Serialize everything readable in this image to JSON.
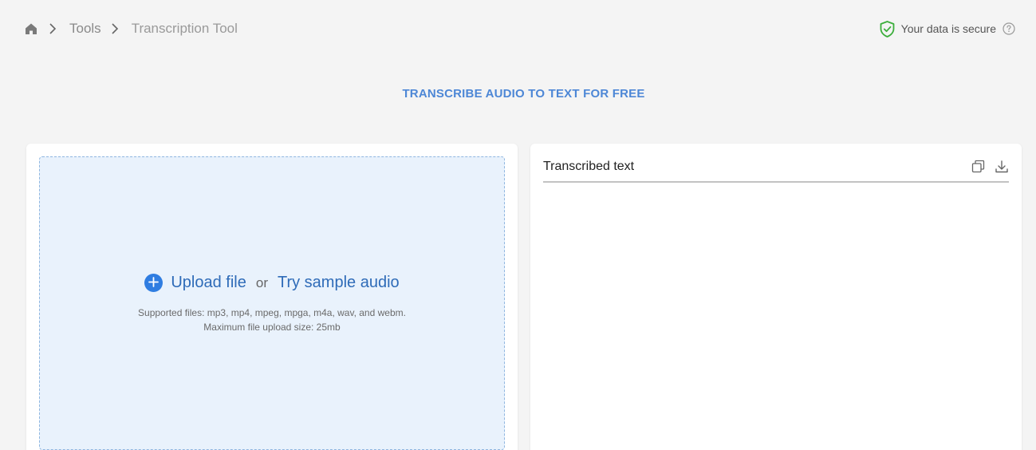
{
  "breadcrumb": {
    "items": [
      {
        "label": "Tools"
      },
      {
        "label": "Transcription Tool"
      }
    ]
  },
  "security": {
    "label": "Your data is secure"
  },
  "hero": {
    "title": "TRANSCRIBE AUDIO TO TEXT FOR FREE"
  },
  "upload": {
    "upload_label": "Upload file",
    "or_label": "or",
    "sample_label": "Try sample audio",
    "supported_files": "Supported files: mp3, mp4, mpeg, mpga, m4a, wav, and webm.",
    "max_size": "Maximum file upload size: 25mb"
  },
  "output": {
    "title": "Transcribed text",
    "text": ""
  },
  "colors": {
    "accent": "#2f7de1",
    "link": "#2e6bb8",
    "hero": "#4d87d6",
    "secure_green": "#3cae3c"
  }
}
